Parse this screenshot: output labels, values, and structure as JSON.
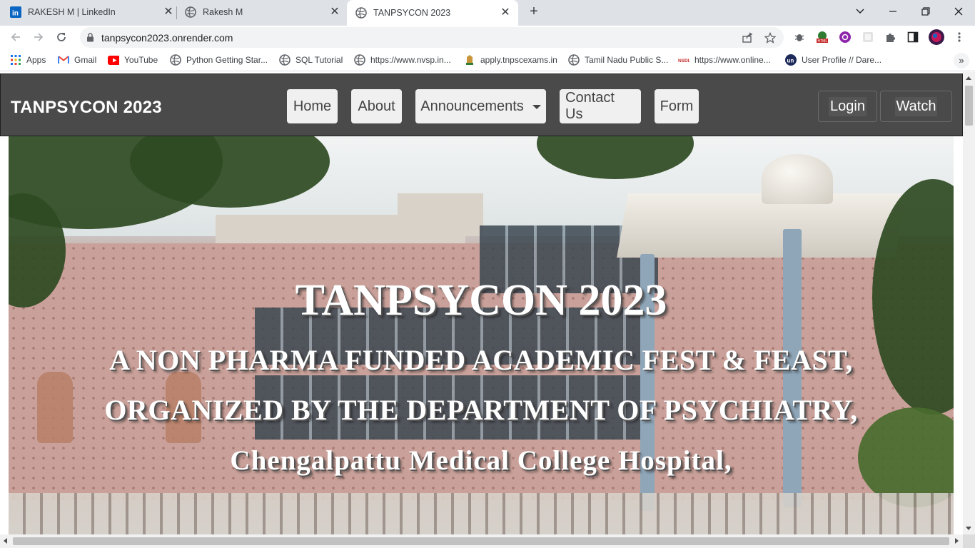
{
  "browser": {
    "tabs": [
      {
        "title": "RAKESH M | LinkedIn",
        "icon": "linkedin-icon",
        "active": false
      },
      {
        "title": "Rakesh M",
        "icon": "globe-icon",
        "active": false
      },
      {
        "title": "TANPSYCON 2023",
        "icon": "globe-icon",
        "active": true
      }
    ],
    "new_tab": "+",
    "url": "tanpsycon2023.onrender.com",
    "bookmarks": [
      {
        "label": "Apps",
        "icon": "apps-grid-icon"
      },
      {
        "label": "Gmail",
        "icon": "gmail-icon"
      },
      {
        "label": "YouTube",
        "icon": "youtube-icon"
      },
      {
        "label": "Python Getting Star...",
        "icon": "globe-icon"
      },
      {
        "label": "SQL Tutorial",
        "icon": "globe-icon"
      },
      {
        "label": "https://www.nvsp.in...",
        "icon": "globe-icon"
      },
      {
        "label": "apply.tnpscexams.in",
        "icon": "emblem-icon"
      },
      {
        "label": "Tamil Nadu Public S...",
        "icon": "globe-icon"
      },
      {
        "label": "https://www.online...",
        "icon": "nsdl-icon"
      },
      {
        "label": "User Profile // Dare...",
        "icon": "un-icon"
      }
    ],
    "more_bookmarks": "»"
  },
  "site": {
    "brand": "TANPSYCON 2023",
    "nav": {
      "home": "Home",
      "about": "About",
      "announcements": "Announcements",
      "contact": "Contact Us",
      "form": "Form"
    },
    "login": "Login",
    "watch": "Watch"
  },
  "hero": {
    "title": "TANPSYCON 2023",
    "line1": "A NON PHARMA FUNDED ACADEMIC FEST & FEAST,",
    "line2": "ORGANIZED BY THE DEPARTMENT OF PSYCHIATRY,",
    "line3": "Chengalpattu Medical College Hospital,"
  },
  "colors": {
    "navbar": "#4a4a4a",
    "nav_button": "#f0f0f0",
    "text_dark": "#444444",
    "chrome_tabbar": "#dee1e6"
  }
}
